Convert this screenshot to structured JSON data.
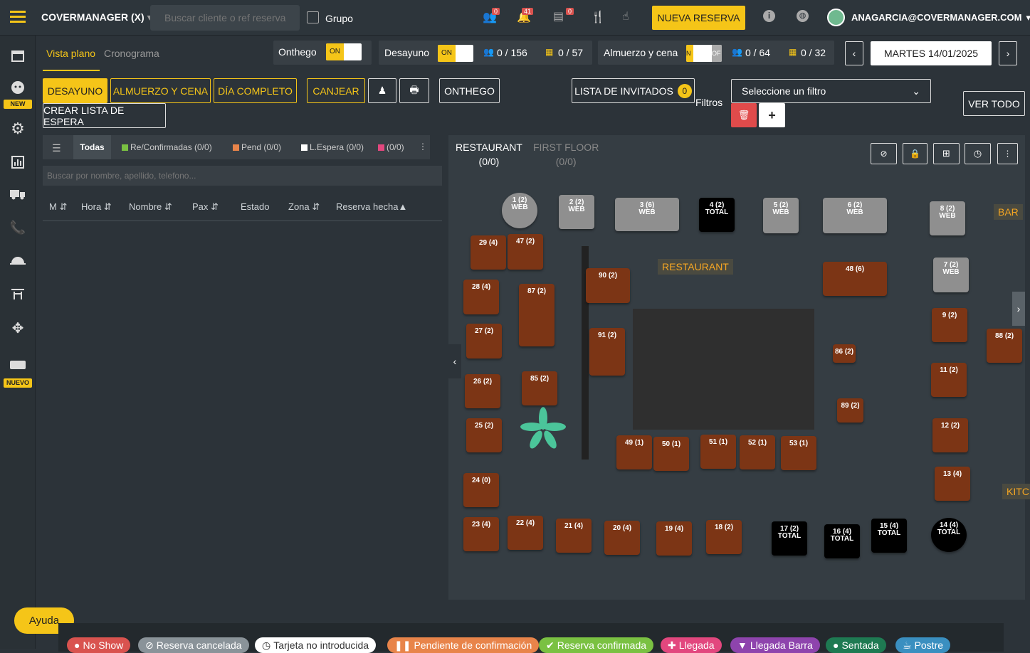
{
  "topbar": {
    "brand": "COVERMANAGER (X)",
    "search_placeholder": "Buscar cliente o ref reserva",
    "group_label": "Grupo",
    "badges": {
      "users": "0",
      "bell": "41",
      "list": "0"
    },
    "new_reservation": "NUEVA RESERVA",
    "user": "ANAGARCIA@COVERMANAGER.COM"
  },
  "sidebar": {
    "badge_new": "NEW",
    "badge_nuevo": "NUEVO"
  },
  "view_tabs": {
    "plano": "Vista plano",
    "crono": "Cronograma"
  },
  "services": {
    "onthego": {
      "label": "Onthego",
      "state": "ON"
    },
    "desayuno": {
      "label": "Desayuno",
      "state": "ON",
      "pax": "0 / 156",
      "tables": "0 / 57"
    },
    "almuerzo": {
      "label": "Almuerzo y cena",
      "state_on": "N",
      "state_off": "OF",
      "pax": "0 / 64",
      "tables": "0 / 32"
    }
  },
  "date": "MARTES 14/01/2025",
  "actions": {
    "desayuno": "DESAYUNO",
    "almuerzo": "ALMUERZO Y CENA",
    "dia": "DÍA COMPLETO",
    "canjear": "CANJEAR",
    "onthego": "ONTHEGO",
    "lista_invitados": "LISTA DE INVITADOS",
    "lista_count": "0",
    "espera": "CREAR LISTA DE ESPERA",
    "filtros": "Filtros",
    "filter_select": "Seleccione un filtro",
    "ver_todo": "VER TODO"
  },
  "list_filters": {
    "todas": "Todas",
    "confirmadas": "Re/Confirmadas (0/0)",
    "pend": "Pend (0/0)",
    "espera": "L.Espera (0/0)",
    "otro": "(0/0)"
  },
  "list_search_placeholder": "Buscar por nombre, apellido, telefono...",
  "columns": [
    "M ⇵",
    "Hora ⇵",
    "Nombre ⇵",
    "Pax ⇵",
    "Estado",
    "Zona ⇵",
    "Reserva hecha▲"
  ],
  "floor": {
    "zones": [
      {
        "name": "RESTAURANT",
        "count": "(0/0)"
      },
      {
        "name": "FIRST FLOOR",
        "count": "(0/0)"
      }
    ],
    "labels": {
      "restaurant": "RESTAURANT",
      "bar": "BAR",
      "kitchen": "KITC"
    },
    "tables": [
      {
        "l1": "1 (2)",
        "l2": "WEB"
      },
      {
        "l1": "2 (2)",
        "l2": "WEB"
      },
      {
        "l1": "3 (6)",
        "l2": "WEB"
      },
      {
        "l1": "4 (2)",
        "l2": "TOTAL"
      },
      {
        "l1": "5 (2)",
        "l2": "WEB"
      },
      {
        "l1": "6 (2)",
        "l2": "WEB"
      },
      {
        "l1": "8 (2)",
        "l2": "WEB"
      },
      {
        "l1": "29 (4)"
      },
      {
        "l1": "47 (2)"
      },
      {
        "l1": "28 (4)"
      },
      {
        "l1": "87 (2)"
      },
      {
        "l1": "90 (2)"
      },
      {
        "l1": "48 (6)"
      },
      {
        "l1": "7 (2)",
        "l2": "WEB"
      },
      {
        "l1": "27 (2)"
      },
      {
        "l1": "91 (2)"
      },
      {
        "l1": "9 (2)"
      },
      {
        "l1": "88 (2)"
      },
      {
        "l1": "86 (2)"
      },
      {
        "l1": "26 (2)"
      },
      {
        "l1": "85 (2)"
      },
      {
        "l1": "11 (2)"
      },
      {
        "l1": "89 (2)"
      },
      {
        "l1": "25 (2)"
      },
      {
        "l1": "12 (2)"
      },
      {
        "l1": "49 (1)"
      },
      {
        "l1": "50 (1)"
      },
      {
        "l1": "51 (1)"
      },
      {
        "l1": "52 (1)"
      },
      {
        "l1": "53 (1)"
      },
      {
        "l1": "24 (0)"
      },
      {
        "l1": "13 (4)"
      },
      {
        "l1": "23 (4)"
      },
      {
        "l1": "22 (4)"
      },
      {
        "l1": "21 (4)"
      },
      {
        "l1": "20 (4)"
      },
      {
        "l1": "19 (4)"
      },
      {
        "l1": "18 (2)"
      },
      {
        "l1": "17 (2)",
        "l2": "TOTAL"
      },
      {
        "l1": "16 (4)",
        "l2": "TOTAL"
      },
      {
        "l1": "15 (4)",
        "l2": "TOTAL"
      },
      {
        "l1": "14 (4)",
        "l2": "TOTAL"
      }
    ]
  },
  "help": "Ayuda",
  "legend": [
    "No Show",
    "Reserva cancelada",
    "Tarjeta no introducida",
    "Pendiente de confirmación",
    "Reserva confirmada",
    "Llegada",
    "Llegada Barra",
    "Sentada",
    "Postre"
  ],
  "colors": {
    "accent": "#f5c518",
    "table": "#7c3515",
    "web_table": "#8f8f8f",
    "total_table": "#000000"
  }
}
